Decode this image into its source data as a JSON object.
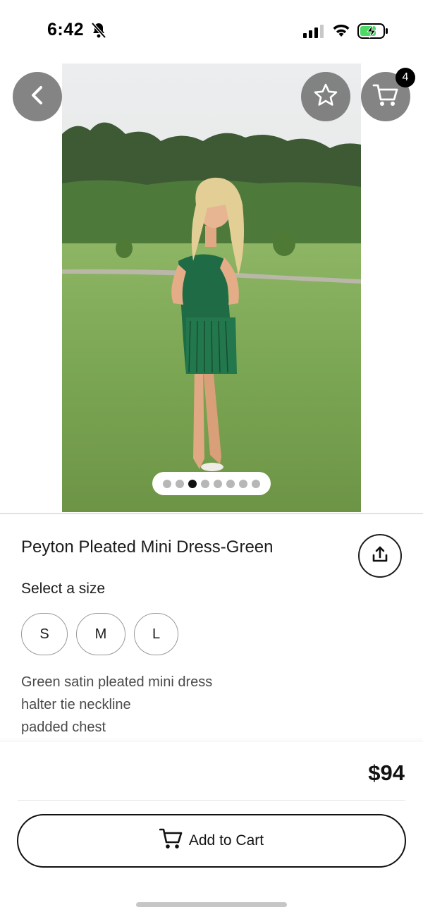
{
  "status_bar": {
    "time": "6:42",
    "icons": [
      "bell-slash-icon",
      "signal-icon",
      "wifi-icon",
      "battery-charging-icon"
    ]
  },
  "photo": {
    "alt": "Model wearing green pleated mini dress in a grassy field",
    "image_count": 8,
    "active_index": 2
  },
  "header_buttons": {
    "back": "chevron-left-icon",
    "favorite": "star-icon",
    "cart": "cart-icon",
    "cart_count": "4"
  },
  "product": {
    "title": "Peyton Pleated Mini Dress-Green",
    "size_label": "Select a size",
    "sizes": [
      "S",
      "M",
      "L"
    ],
    "description": [
      "Green satin pleated mini dress",
      "halter tie neckline",
      "padded chest"
    ],
    "price": "$94"
  },
  "actions": {
    "share": "share-icon",
    "add_to_cart": "Add to Cart"
  },
  "colors": {
    "dress": "#1f6b45",
    "grass": "#7aa552",
    "button_overlay": "#6e6e6e"
  }
}
